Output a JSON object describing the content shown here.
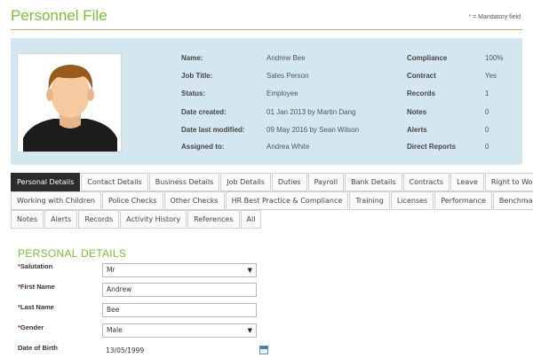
{
  "header": {
    "title": "Personnel File",
    "mandatory_note": "* = Mandatory field"
  },
  "profile": {
    "left": [
      {
        "label": "Name:",
        "value": "Andrew Bee"
      },
      {
        "label": "Job Title:",
        "value": "Sales Person"
      },
      {
        "label": "Status:",
        "value": "Employee"
      },
      {
        "label": "Date created:",
        "value": "01 Jan 2013 by Martin Dang"
      },
      {
        "label": "Date last modified:",
        "value": "09 May 2016 by Sean Wilson"
      },
      {
        "label": "Assigned to:",
        "value": "Andrea White"
      }
    ],
    "right": [
      {
        "label": "Compliance",
        "value": "100%"
      },
      {
        "label": "Contract",
        "value": "Yes"
      },
      {
        "label": "Records",
        "value": "1"
      },
      {
        "label": "Notes",
        "value": "0"
      },
      {
        "label": "Alerts",
        "value": "0"
      },
      {
        "label": "Direct Reports",
        "value": "0"
      }
    ]
  },
  "tabs": {
    "row1": [
      "Personal Details",
      "Contact Details",
      "Business Details",
      "Job Details",
      "Duties",
      "Payroll",
      "Bank Details",
      "Contracts",
      "Leave",
      "Right to Work"
    ],
    "row2": [
      "Working with Children",
      "Police Checks",
      "Other Checks",
      "HR Best Practice & Compliance",
      "Training",
      "Licenses",
      "Performance",
      "Benchmarking"
    ],
    "row3": [
      "Notes",
      "Alerts",
      "Records",
      "Activity History",
      "References",
      "All"
    ],
    "active": "Personal Details"
  },
  "form": {
    "section_title": "PERSONAL DETAILS",
    "salutation": {
      "label": "Salutation",
      "value": "Mr"
    },
    "first_name": {
      "label": "First Name",
      "value": "Andrew"
    },
    "last_name": {
      "label": "Last Name",
      "value": "Bee"
    },
    "gender": {
      "label": "Gender",
      "value": "Male"
    },
    "dob": {
      "label": "Date of Birth",
      "value": "13/05/1999"
    },
    "required_mark": "*",
    "dropdown_arrow": "▼"
  },
  "colors": {
    "title": "#7dbb3c",
    "profile_bg": "#d4e7f0",
    "active_tab": "#2c2c2c",
    "required": "#d02020"
  },
  "icons": {
    "avatar": "person-avatar",
    "calendar": "calendar-icon",
    "dropdown": "chevron-down-icon"
  }
}
